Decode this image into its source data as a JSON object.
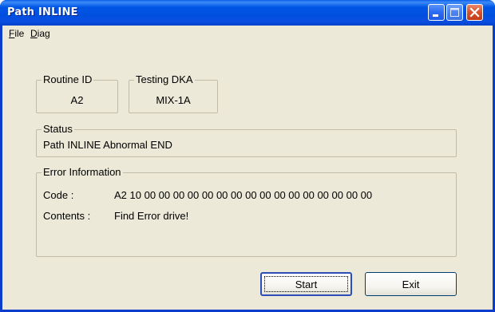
{
  "window": {
    "title": "Path INLINE"
  },
  "menu": {
    "file": {
      "accel": "F",
      "rest": "ile"
    },
    "diag": {
      "accel": "D",
      "rest": "iag"
    }
  },
  "routine": {
    "label": "Routine ID",
    "value": "A2"
  },
  "testing": {
    "label": "Testing DKA",
    "value": "MIX-1A"
  },
  "status": {
    "label": "Status",
    "value": "Path INLINE Abnormal END"
  },
  "error": {
    "label": "Error Information",
    "code_label": "Code :",
    "code_value": "A2 10 00 00 00 00 00 00 00 00 00 00 00 00 00 00 00 00",
    "contents_label": "Contents :",
    "contents_value": "Find Error drive!"
  },
  "buttons": {
    "start": "Start",
    "exit": "Exit"
  },
  "colors": {
    "titlebar": "#0055e5",
    "window_bg": "#ece9d8",
    "close_button": "#d9532e"
  }
}
